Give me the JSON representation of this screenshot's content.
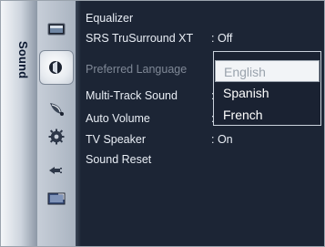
{
  "category": {
    "label": "Sound"
  },
  "icons": [
    {
      "name": "picture-icon"
    },
    {
      "name": "sound-speaker-icon"
    },
    {
      "name": "channel-dish-icon"
    },
    {
      "name": "setup-gear-icon"
    },
    {
      "name": "input-plug-icon"
    },
    {
      "name": "application-icon"
    }
  ],
  "menu": {
    "items": [
      {
        "label": "Equalizer",
        "value": ""
      },
      {
        "label": "SRS TruSurround XT",
        "value": ": Off"
      },
      {
        "label": "Preferred Language",
        "value": ""
      },
      {
        "label": "Multi-Track Sound",
        "value": ":"
      },
      {
        "label": "Auto Volume",
        "value": ":"
      },
      {
        "label": "TV Speaker",
        "value": ": On"
      },
      {
        "label": "Sound Reset",
        "value": ""
      }
    ]
  },
  "dropdown": {
    "options": [
      {
        "label": "English",
        "selected": true
      },
      {
        "label": "Spanish",
        "selected": false
      },
      {
        "label": "French",
        "selected": false
      }
    ]
  }
}
